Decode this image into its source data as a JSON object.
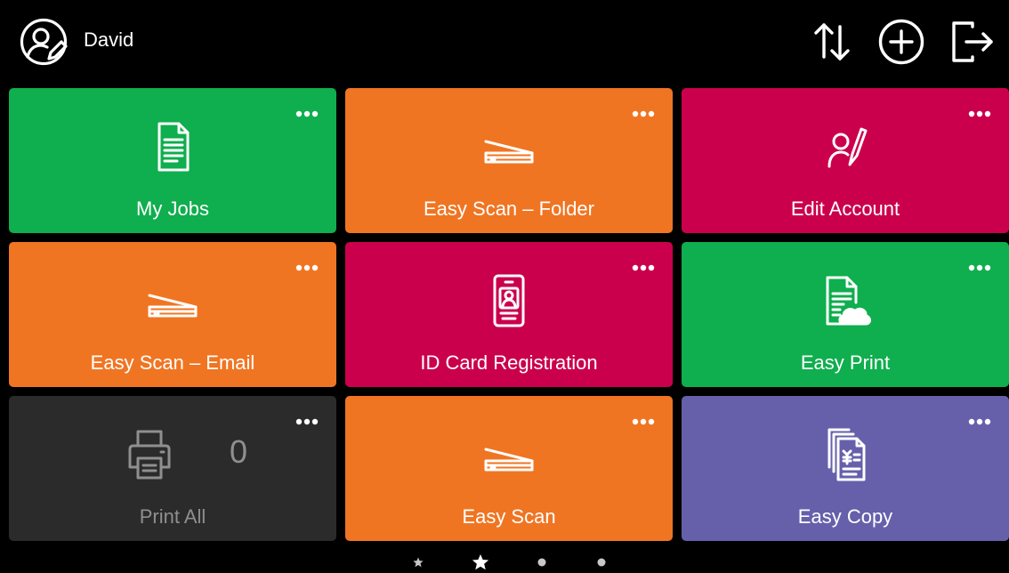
{
  "user": {
    "name": "David",
    "icon": "user-edit-icon"
  },
  "header": {
    "actions": [
      {
        "name": "sort-icon"
      },
      {
        "name": "add-icon"
      },
      {
        "name": "logout-icon"
      }
    ]
  },
  "tiles": [
    {
      "label": "My Jobs",
      "color": "#0fae4e",
      "icon": "document-icon"
    },
    {
      "label": "Easy Scan – Folder",
      "color": "#f07522",
      "icon": "scanner-icon"
    },
    {
      "label": "Edit Account",
      "color": "#cb004c",
      "icon": "user-edit-icon"
    },
    {
      "label": "Easy Scan – Email",
      "color": "#f07522",
      "icon": "scanner-icon"
    },
    {
      "label": "ID Card Registration",
      "color": "#cb004c",
      "icon": "id-card-icon"
    },
    {
      "label": "Easy Print",
      "color": "#0fae4e",
      "icon": "cloud-document-icon"
    },
    {
      "label": "Print All",
      "color": "#2b2b2b",
      "icon": "printer-icon",
      "count": "0"
    },
    {
      "label": "Easy Scan",
      "color": "#f07522",
      "icon": "scanner-icon"
    },
    {
      "label": "Easy Copy",
      "color": "#6660ab",
      "icon": "copy-icon"
    }
  ],
  "pager": {
    "pages": [
      {
        "type": "star",
        "active": false
      },
      {
        "type": "star",
        "active": true
      },
      {
        "type": "dot",
        "active": false
      },
      {
        "type": "dot",
        "active": false
      }
    ]
  }
}
